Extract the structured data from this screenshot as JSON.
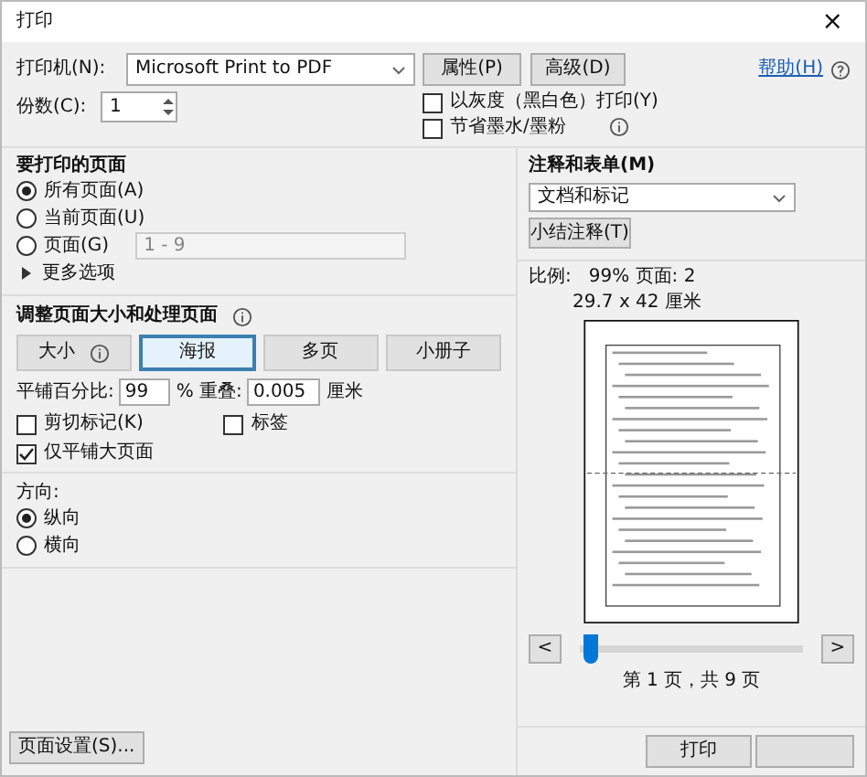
{
  "window": {
    "title": "打印",
    "close": "×"
  },
  "printer": {
    "label": "打印机(N):",
    "value": "Microsoft Print to PDF",
    "buttons": [
      "属性(P)",
      "高级(D)"
    ],
    "help": "帮助(H)"
  },
  "copies": {
    "label": "份数(C):",
    "value": "1"
  },
  "options": [
    {
      "label": "以灰度（黑白色）打印(Y)",
      "checked": false,
      "info": false
    },
    {
      "label": "节省墨水/墨粉",
      "checked": false,
      "info": true
    }
  ],
  "pages": {
    "title": "要打印的页面",
    "radios": [
      {
        "label": "所有页面(A)",
        "selected": true
      },
      {
        "label": "当前页面(U)",
        "selected": false
      },
      {
        "label": "页面(G)",
        "selected": false
      }
    ],
    "range_placeholder": "1 - 9",
    "more": "更多选项"
  },
  "sizing": {
    "title": "调整页面大小和处理页面",
    "tabs": [
      {
        "label": "大小",
        "selected": false,
        "info": true
      },
      {
        "label": "海报",
        "selected": true,
        "info": false
      },
      {
        "label": "多页",
        "selected": false,
        "info": false
      },
      {
        "label": "小册子",
        "selected": false,
        "info": false
      }
    ],
    "tile_label": "平铺百分比:",
    "tile_value": "99",
    "overlap_label": "% 重叠:",
    "overlap_value": "0.005",
    "unit": "厘米",
    "checks": [
      {
        "label": "剪切标记(K)",
        "checked": false
      },
      {
        "label": "标签",
        "checked": false
      },
      {
        "label": "仅平铺大页面",
        "checked": true
      }
    ]
  },
  "orientation": {
    "title": "方向:",
    "radios": [
      {
        "label": "纵向",
        "selected": true
      },
      {
        "label": "横向",
        "selected": false
      }
    ]
  },
  "annotations": {
    "title": "注释和表单(M)",
    "value": "文档和标记",
    "summary_button": "小结注释(T)"
  },
  "preview": {
    "scale": "比例:   99% 页面: 2",
    "size": "29.7 x 42 厘米",
    "prev": "<",
    "next": ">",
    "level": 0.05,
    "page_info": "第 1 页，共 9 页"
  },
  "footer": {
    "page_setup": "页面设置(S)...",
    "print": "打印"
  }
}
